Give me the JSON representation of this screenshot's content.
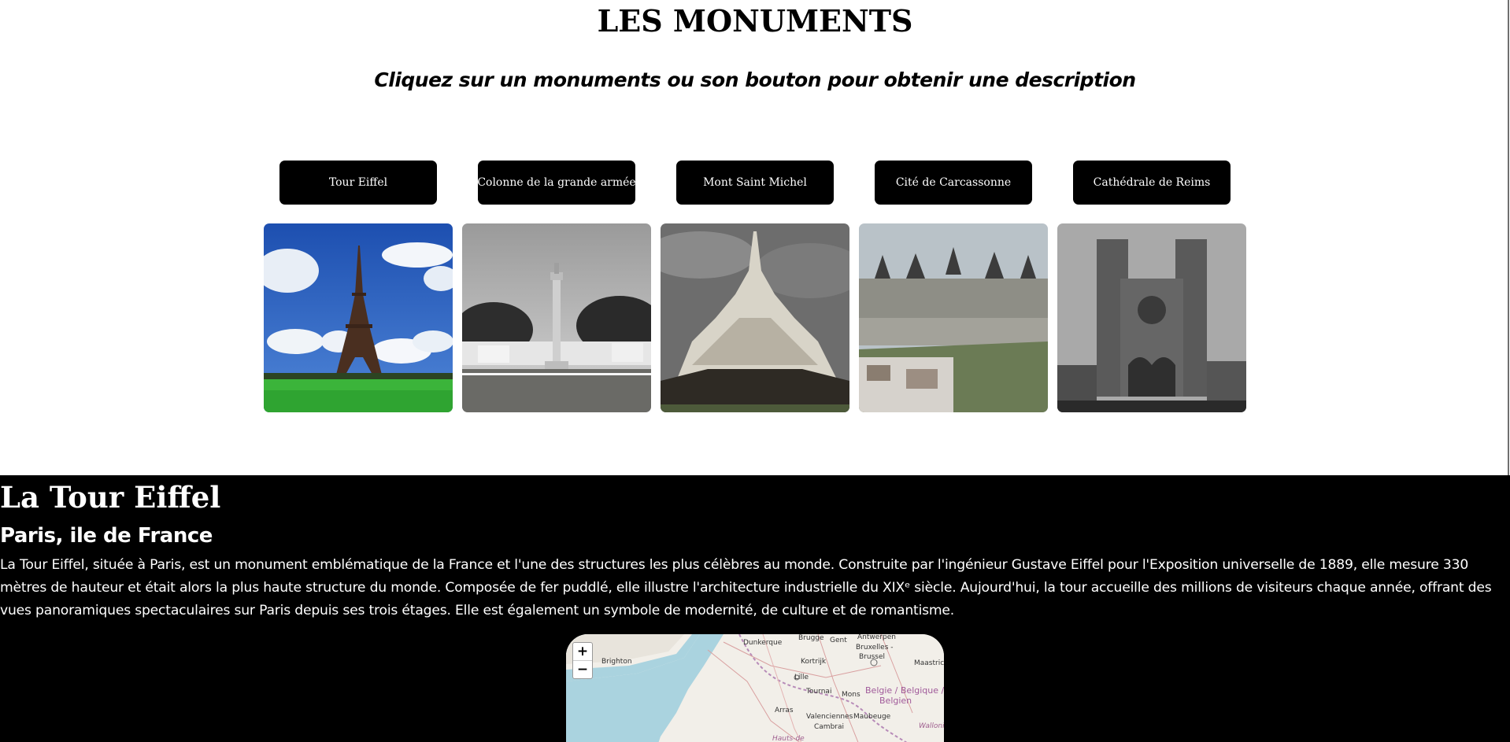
{
  "header": {
    "title": "LES MONUMENTS",
    "subtitle": "Cliquez sur un monuments ou son bouton pour obtenir une description"
  },
  "buttons": [
    {
      "label": "Tour Eiffel"
    },
    {
      "label": "Colonne de la grande armée"
    },
    {
      "label": "Mont Saint Michel"
    },
    {
      "label": "Cité de Carcassonne"
    },
    {
      "label": "Cathédrale de Reims"
    }
  ],
  "images": [
    {
      "subject": "eiffel-tower"
    },
    {
      "subject": "column"
    },
    {
      "subject": "mont-saint-michel"
    },
    {
      "subject": "carcassonne"
    },
    {
      "subject": "reims-cathedral"
    }
  ],
  "detail": {
    "title": "La Tour Eiffel",
    "location": "Paris, ile de France",
    "description": "La Tour Eiffel, située à Paris, est un monument emblématique de la France et l'une des structures les plus célèbres au monde. Construite par l'ingénieur Gustave Eiffel pour l'Exposition universelle de 1889, elle mesure 330 mètres de hauteur et était alors la plus haute structure du monde. Composée de fer puddlé, elle illustre l'architecture industrielle du XIXᵉ siècle. Aujourd'hui, la tour accueille des millions de visiteurs chaque année, offrant des vues panoramiques spectaculaires sur Paris depuis ses trois étages. Elle est également un symbole de modernité, de culture et de romantisme."
  },
  "map": {
    "zoom_in": "+",
    "zoom_out": "−",
    "labels": {
      "brighton": "Brighton",
      "dunkerque": "Dunkerque",
      "brugge": "Brugge",
      "gent": "Gent",
      "antwerpen": "Antwerpen",
      "bruxelles": "Bruxelles -",
      "brussel": "Brussel",
      "kortrijk": "Kortrijk",
      "lille": "Lille",
      "maastricht": "Maastricht",
      "tournai": "Tournai",
      "mons": "Mons",
      "belgie": "Belgie / Belgique /",
      "belgien": "Belgien",
      "arras": "Arras",
      "valenciennes": "Valenciennes",
      "maubeuge": "Maubeuge",
      "cambrai": "Cambrai",
      "wallonie": "Wallonie",
      "hauts": "Hauts-de"
    }
  },
  "colors": {
    "background": "#ffffff",
    "button_bg": "#000000",
    "detail_bg": "#000000",
    "detail_text": "#ffffff"
  }
}
